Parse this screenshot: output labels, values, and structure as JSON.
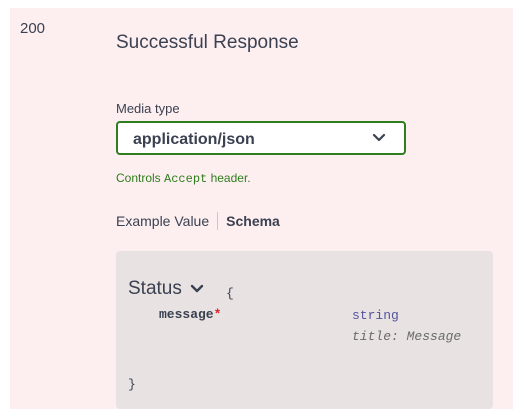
{
  "response": {
    "code": "200",
    "description": "Successful Response",
    "media_type_label": "Media type",
    "media_type_value": "application/json",
    "controls_prefix": "Controls ",
    "controls_code": "Accept",
    "controls_suffix": " header."
  },
  "tabs": {
    "example_value": "Example Value",
    "schema": "Schema",
    "active": "schema"
  },
  "model": {
    "name": "Status",
    "open_brace": "{",
    "close_brace": "}",
    "properties": [
      {
        "name": "message",
        "required_marker": "*",
        "type": "string",
        "title": "title: Message"
      }
    ]
  },
  "colors": {
    "panel_bg": "#fdeff0",
    "accent_green": "#2f7d1e",
    "type_purple": "#55549e",
    "required_red": "#e0252b"
  },
  "icons": {
    "select_chevron": "chevron-down-icon",
    "model_toggle": "chevron-down-icon"
  }
}
